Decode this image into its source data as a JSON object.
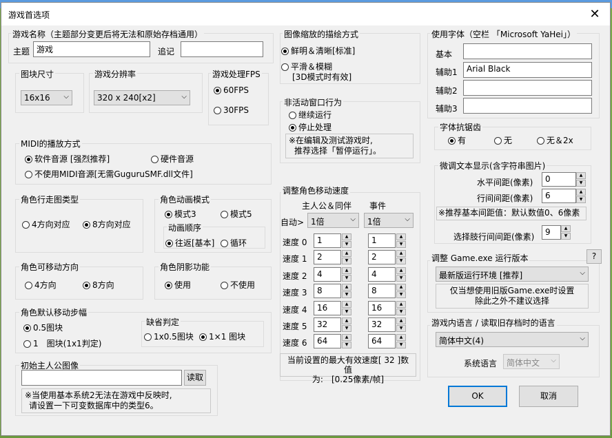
{
  "window": {
    "title": "游戏首选项",
    "close_glyph": "✕"
  },
  "game_name": {
    "legend": "游戏名称（主题部分变更后将无法和原始存档通用）",
    "main_label": "主题",
    "main_value": "游戏",
    "append_label": "追记",
    "append_value": ""
  },
  "tile_size": {
    "legend": "图块尺寸",
    "value": "16x16"
  },
  "resolution": {
    "legend": "游戏分辨率",
    "value": "320 x 240[x2]"
  },
  "fps": {
    "legend": "游戏处理FPS",
    "opt60": "60FPS",
    "opt30": "30FPS",
    "selected": "60FPS"
  },
  "scaling": {
    "legend": "图像缩放的描绘方式",
    "opt_sharp": "鲜明＆清晰[标准]",
    "opt_smooth_1": "平滑＆模糊",
    "opt_smooth_2": "[3D模式时有效]",
    "selected": "sharp"
  },
  "inactive": {
    "legend": "非活动窗口行为",
    "opt_continue": "继续运行",
    "opt_stop": "停止处理",
    "note_1": "※在编辑及测试游戏时,",
    "note_2": "推荐选择「暂停运行」。",
    "selected": "stop"
  },
  "fonts": {
    "legend": "使用字体（空栏 「Microsoft YaHei」）",
    "basic_label": "基本",
    "basic_value": "",
    "aux1_label": "辅助1",
    "aux1_value": "Arial Black",
    "aux2_label": "辅助2",
    "aux2_value": "",
    "aux3_label": "辅助3",
    "aux3_value": ""
  },
  "antialias": {
    "legend": "字体抗锯齿",
    "opt_yes": "有",
    "opt_no": "无",
    "opt_2x": "无＆2x",
    "selected": "yes"
  },
  "fine_text": {
    "legend": "微调文本显示(含字符串图片)",
    "h_label": "水平间距(像素)",
    "h_value": "0",
    "line_label": "行间间距(像素)",
    "line_value": "6",
    "note": "※推荐基本间距值：默认数值0、6像素",
    "choice_label": "选择肢行间间距(像素)",
    "choice_value": "9"
  },
  "midi": {
    "legend": "MIDI的播放方式",
    "opt_soft": "软件音源 [强烈推荐]",
    "opt_hard": "硬件音源",
    "opt_none": "不使用MIDI音源[无需GuguruSMF.dll文件]",
    "selected": "soft"
  },
  "walk_type": {
    "legend": "角色行走图类型",
    "opt4": "4方向对应",
    "opt8": "8方向对应",
    "selected": "8"
  },
  "anim_mode": {
    "legend": "角色动画模式",
    "opt3": "模式3",
    "opt5": "模式5",
    "selected": "3",
    "order_legend": "动画顺序",
    "opt_round": "往返[基本]",
    "opt_loop": "循环",
    "order_selected": "round"
  },
  "move_dir": {
    "legend": "角色可移动方向",
    "opt4": "4方向",
    "opt8": "8方向",
    "selected": "8"
  },
  "shadow": {
    "legend": "角色阴影功能",
    "opt_use": "使用",
    "opt_off": "不使用",
    "selected": "use"
  },
  "step": {
    "legend": "角色默认移动步幅",
    "opt_half": "0.5图块",
    "opt_one": "1　图块(1x1判定)",
    "selected": "half",
    "judge_legend": "缺省判定",
    "judge_half": "1x0.5图块",
    "judge_one": "1×1  图块",
    "judge_selected": "one"
  },
  "speed": {
    "legend": "调整角色移动速度",
    "col_hero": "主人公＆同伴",
    "col_event": "事件",
    "auto_label": "自动>",
    "hero_mult": "1倍",
    "event_mult": "1倍",
    "rows": [
      {
        "label": "速度 0",
        "hero": "1",
        "event": "1"
      },
      {
        "label": "速度 1",
        "hero": "2",
        "event": "2"
      },
      {
        "label": "速度 2",
        "hero": "4",
        "event": "4"
      },
      {
        "label": "速度 3",
        "hero": "8",
        "event": "8"
      },
      {
        "label": "速度 4",
        "hero": "16",
        "event": "16"
      },
      {
        "label": "速度 5",
        "hero": "32",
        "event": "32"
      },
      {
        "label": "速度 6",
        "hero": "64",
        "event": "64"
      }
    ],
    "note_1": "当前设置的最大有效速度[ 32 ]数值",
    "note_2": "为:　[0.25像素/帧]"
  },
  "runtime": {
    "legend": "调整 Game.exe 运行版本",
    "help": "?",
    "value": "最新版运行环境 [推荐]",
    "note_1": "仅当想使用旧版Game.exe时设置",
    "note_2": "除此之外不建议选择"
  },
  "language": {
    "legend": "游戏内语言 / 读取旧存档时的语言",
    "value": "简体中文(4)",
    "sys_label": "系统语言",
    "sys_value": "简体中文"
  },
  "hero_image": {
    "legend": "初始主人公图像",
    "path": "",
    "load": "读取",
    "note_1": "※当使用基本系统2无法在游戏中反映时,",
    "note_2": "请设置一下可变数据库中的类型6。"
  },
  "buttons": {
    "ok": "OK",
    "cancel": "取消"
  }
}
